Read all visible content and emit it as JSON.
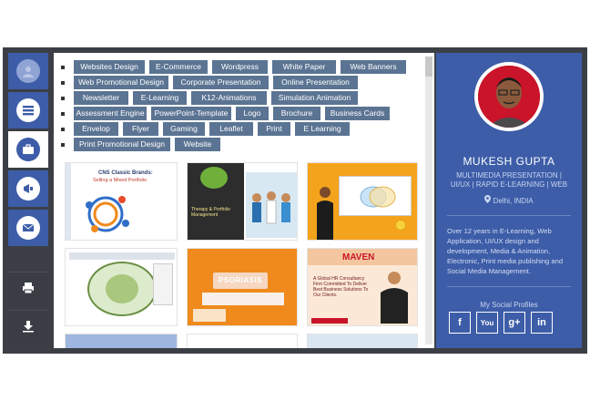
{
  "nav": {
    "items": [
      {
        "icon": "user-icon"
      },
      {
        "icon": "list-icon"
      },
      {
        "icon": "briefcase-icon"
      },
      {
        "icon": "megaphone-icon"
      },
      {
        "icon": "envelope-icon"
      }
    ],
    "print_icon": "print-icon",
    "download_icon": "download-icon"
  },
  "tags": [
    [
      "Websites Design",
      "E-Commerce",
      "Wordpress",
      "White Paper",
      "Web Banners"
    ],
    [
      "Web Promotional Design",
      "Corporate Presentation",
      "Online Presentation"
    ],
    [
      "Newsletter",
      "E-Learning",
      "K12-Animations",
      "Simulation Animation"
    ],
    [
      "Assessment Engine",
      "PowerPoint-Template",
      "Logo",
      "Brochure",
      "Business Cards"
    ],
    [
      "Envelop",
      "Flyer",
      "Gaming",
      "Leaflet",
      "Print",
      "E Learning"
    ],
    [
      "Print Promotional Design",
      "Website"
    ]
  ],
  "thumbs": {
    "t1": {
      "title": "CNS Classic Brands:",
      "subtitle": "Selling a Mixed Portfolio"
    },
    "t2": {
      "title": "Therapy & Portfolio Management"
    },
    "t3": {
      "title": ""
    },
    "t4": {
      "title": ""
    },
    "t5": {
      "title": "PSORIASIS"
    },
    "t6": {
      "logo": "MAVEN",
      "text": "A Global HR Consultancy Firm Committed To Deliver Best Business Solutions To Our Clients."
    }
  },
  "profile": {
    "name": "MUKESH GUPTA",
    "title": "MULTIMEDIA PRESENTATION | UI/UX | RAPID E-LEARNING | WEB",
    "location": "Delhi, INDIA",
    "bio": "Over 12 years in E-Learning, Web Application, UI/UX design and development, Media & Animation, Electronic, Print media publishing and Social Media Management.",
    "social_title": "My Social Profiles",
    "social": [
      {
        "icon": "facebook-icon",
        "glyph": "f"
      },
      {
        "icon": "youtube-icon",
        "glyph": "You"
      },
      {
        "icon": "google-plus-icon",
        "glyph": "g+"
      },
      {
        "icon": "linkedin-icon",
        "glyph": "in"
      }
    ]
  }
}
